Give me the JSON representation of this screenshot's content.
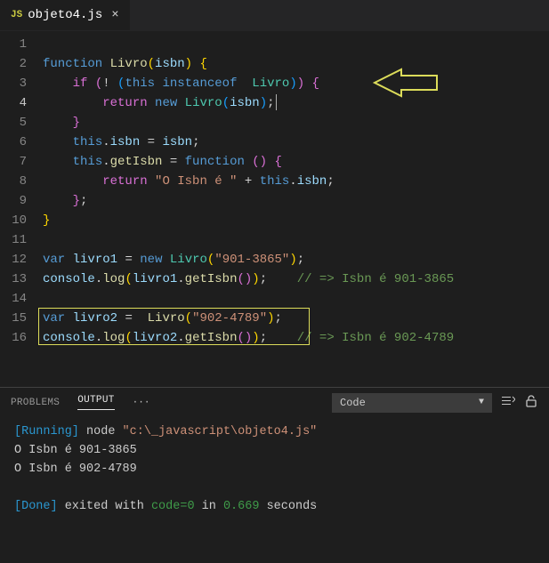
{
  "tab": {
    "icon": "JS",
    "name": "objeto4.js",
    "close": "×"
  },
  "lines": [
    "1",
    "2",
    "3",
    "4",
    "5",
    "6",
    "7",
    "8",
    "9",
    "10",
    "11",
    "12",
    "13",
    "14",
    "15",
    "16"
  ],
  "code": {
    "l2": {
      "kw1": "function",
      "fn": "Livro",
      "param": "isbn"
    },
    "l3": {
      "kw1": "if",
      "kw2": "this",
      "kw3": "instanceof",
      "cls": "Livro"
    },
    "l4": {
      "kw1": "return",
      "kw2": "new",
      "cls": "Livro",
      "var": "isbn"
    },
    "l6": {
      "kw": "this",
      "prop": "isbn",
      "var": "isbn"
    },
    "l7": {
      "kw1": "this",
      "prop": "getIsbn",
      "kw2": "function"
    },
    "l8": {
      "kw": "return",
      "str": "\"O Isbn é \"",
      "kw2": "this",
      "prop": "isbn"
    },
    "l12": {
      "kw1": "var",
      "var": "livro1",
      "kw2": "new",
      "cls": "Livro",
      "str": "\"901-3865\""
    },
    "l13": {
      "obj": "console",
      "fn": "log",
      "var": "livro1",
      "m": "getIsbn",
      "cmt": "// => Isbn é 901-3865"
    },
    "l15": {
      "kw1": "var",
      "var": "livro2",
      "cls": "Livro",
      "str": "\"902-4789\""
    },
    "l16": {
      "obj": "console",
      "fn": "log",
      "var": "livro2",
      "m": "getIsbn",
      "cmt": "// => Isbn é 902-4789"
    }
  },
  "panel": {
    "problems": "PROBLEMS",
    "output": "OUTPUT",
    "more": "···",
    "dropdown": "Code"
  },
  "output": {
    "l1a": "[Running]",
    "l1b": " node ",
    "l1c": "\"c:\\_javascript\\objeto4.js\"",
    "l2": "O Isbn é 901-3865",
    "l3": "O Isbn é 902-4789",
    "l5a": "[Done]",
    "l5b": " exited with ",
    "l5c": "code=0",
    "l5d": " in ",
    "l5e": "0.669",
    "l5f": " seconds"
  }
}
